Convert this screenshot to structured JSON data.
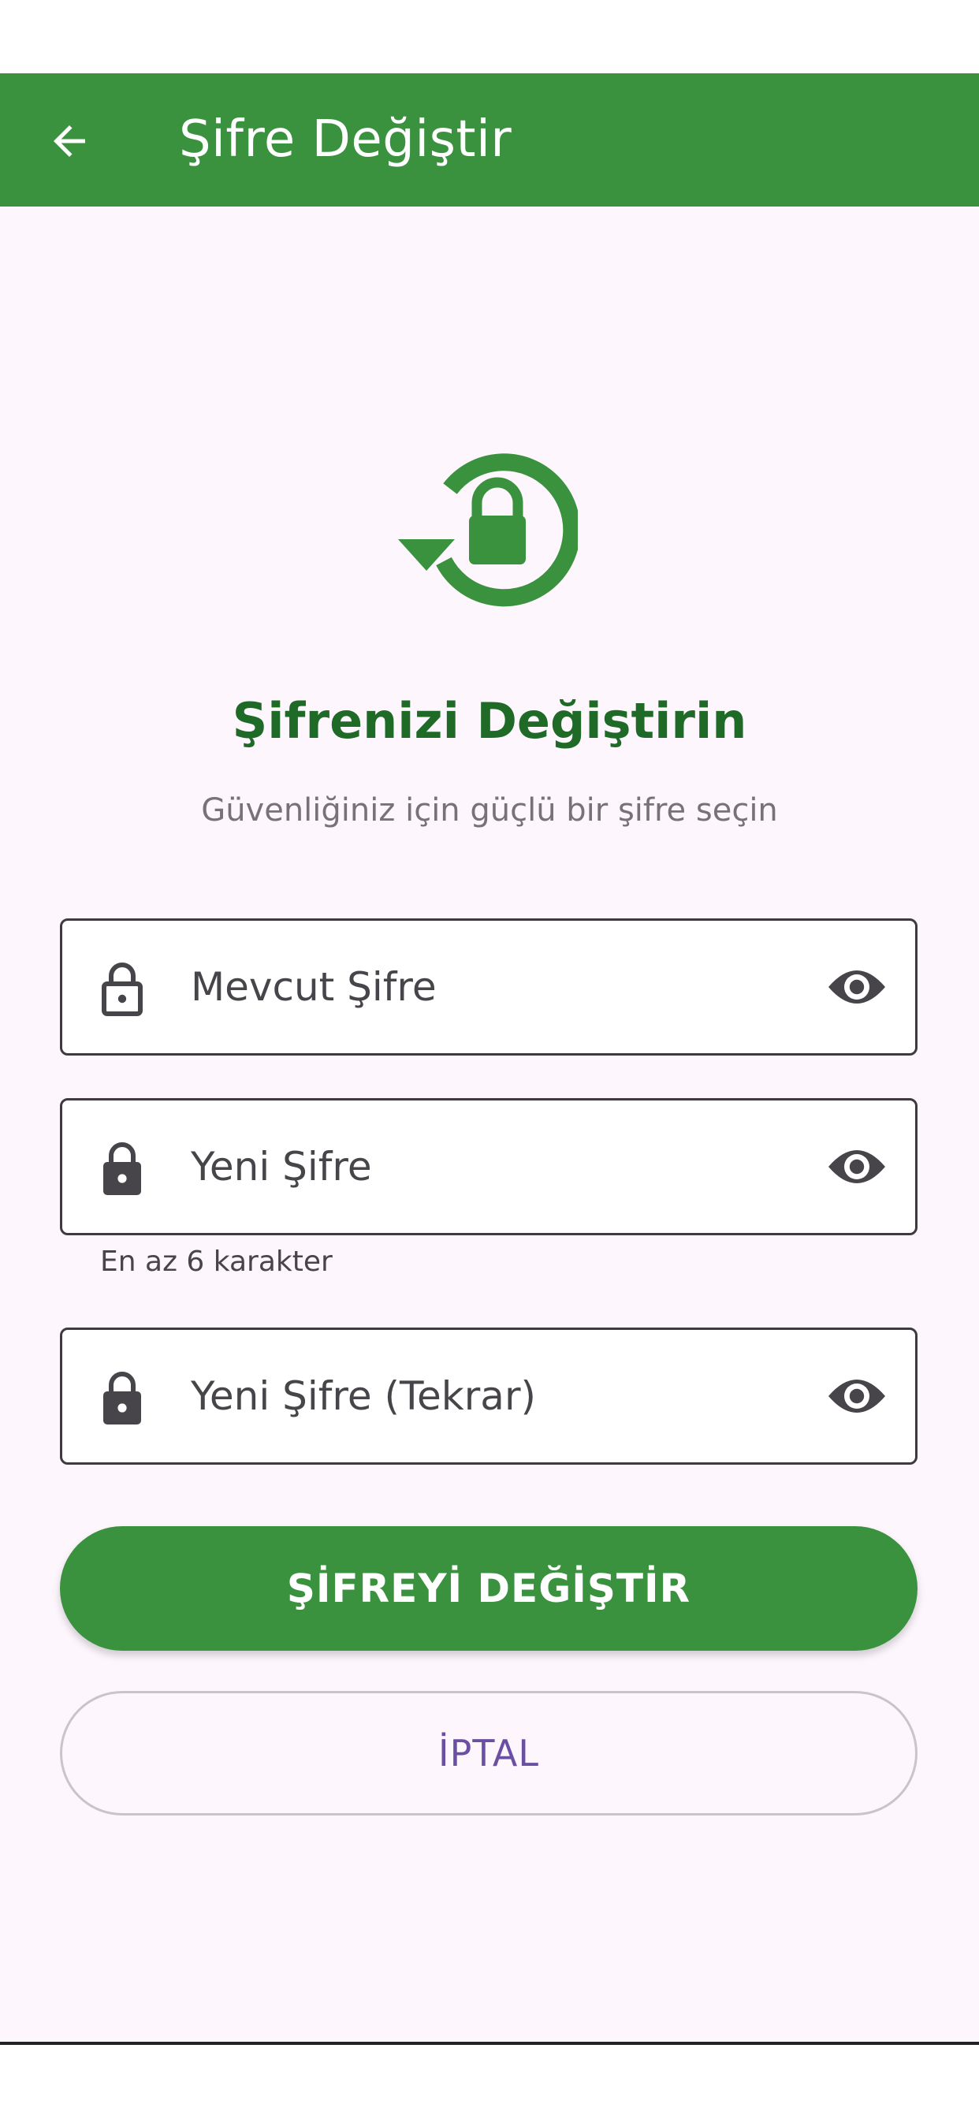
{
  "app_bar": {
    "title": "Şifre Değiştir",
    "back_icon": "arrow-left-icon",
    "color": "#3a923f"
  },
  "hero": {
    "icon": "lock-reset-icon",
    "title": "Şifrenizi Değiştirin",
    "subtitle": "Güvenliğiniz için güçlü bir şifre seçin"
  },
  "form": {
    "current_password": {
      "placeholder": "Mevcut Şifre",
      "lock_icon": "lock-outline-icon",
      "toggle_icon": "eye-icon"
    },
    "new_password": {
      "placeholder": "Yeni Şifre",
      "helper": "En az 6 karakter",
      "lock_icon": "lock-icon",
      "toggle_icon": "eye-icon"
    },
    "confirm_password": {
      "placeholder": "Yeni Şifre (Tekrar)",
      "lock_icon": "lock-icon",
      "toggle_icon": "eye-icon"
    }
  },
  "actions": {
    "submit_label": "ŞİFREYİ DEĞİŞTİR",
    "cancel_label": "İPTAL"
  },
  "colors": {
    "primary": "#3a923f",
    "heading": "#1f6a26",
    "cancel_text": "#6a4fa3",
    "background": "#fdf7fd"
  }
}
